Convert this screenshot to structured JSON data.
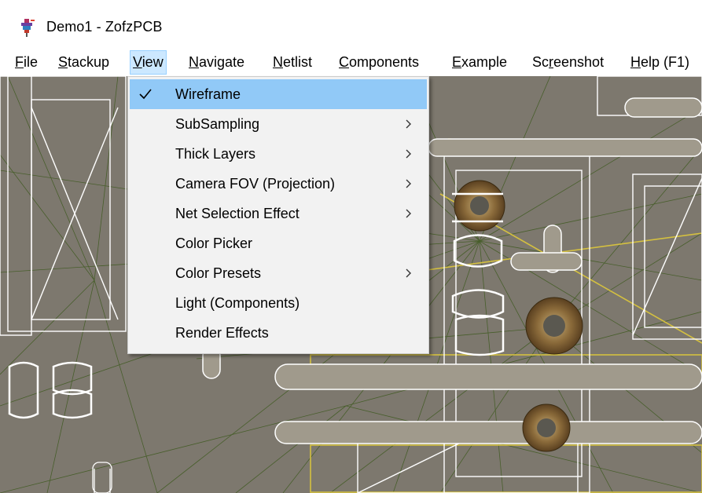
{
  "window": {
    "title": "Demo1 - ZofzPCB",
    "icon": "zofzpcb-app-icon"
  },
  "menubar": {
    "items": [
      {
        "label": "File",
        "mnemonic": "F"
      },
      {
        "label": "Stackup",
        "mnemonic": "S"
      },
      {
        "label": "View",
        "mnemonic": "V",
        "active": true
      },
      {
        "label": "Navigate",
        "mnemonic": "N"
      },
      {
        "label": "Netlist",
        "mnemonic": "N"
      },
      {
        "label": "Components",
        "mnemonic": "C"
      },
      {
        "label": "Example",
        "mnemonic": "E"
      },
      {
        "label": "Screenshot",
        "mnemonic": "r"
      },
      {
        "label": "Help (F1)",
        "mnemonic": "H"
      }
    ]
  },
  "view_menu": {
    "items": [
      {
        "label": "Wireframe",
        "checked": true,
        "highlighted": true,
        "submenu": false
      },
      {
        "label": "SubSampling",
        "checked": false,
        "submenu": true
      },
      {
        "label": "Thick Layers",
        "checked": false,
        "submenu": true
      },
      {
        "label": "Camera FOV (Projection)",
        "checked": false,
        "submenu": true
      },
      {
        "label": "Net Selection Effect",
        "checked": false,
        "submenu": true
      },
      {
        "label": "Color Picker",
        "checked": false,
        "submenu": false
      },
      {
        "label": "Color Presets",
        "checked": false,
        "submenu": true
      },
      {
        "label": "Light (Components)",
        "checked": false,
        "submenu": false
      },
      {
        "label": "Render Effects",
        "checked": false,
        "submenu": false
      }
    ]
  },
  "colors": {
    "menu_highlight": "#91c9f7",
    "menubar_active": "#cce8ff",
    "viewport_bg": "#7a766c",
    "wire_white": "#ffffff",
    "wire_yellow": "#d4c040",
    "wire_green": "#3d5a1e",
    "pad_brown": "#7a5a30"
  }
}
